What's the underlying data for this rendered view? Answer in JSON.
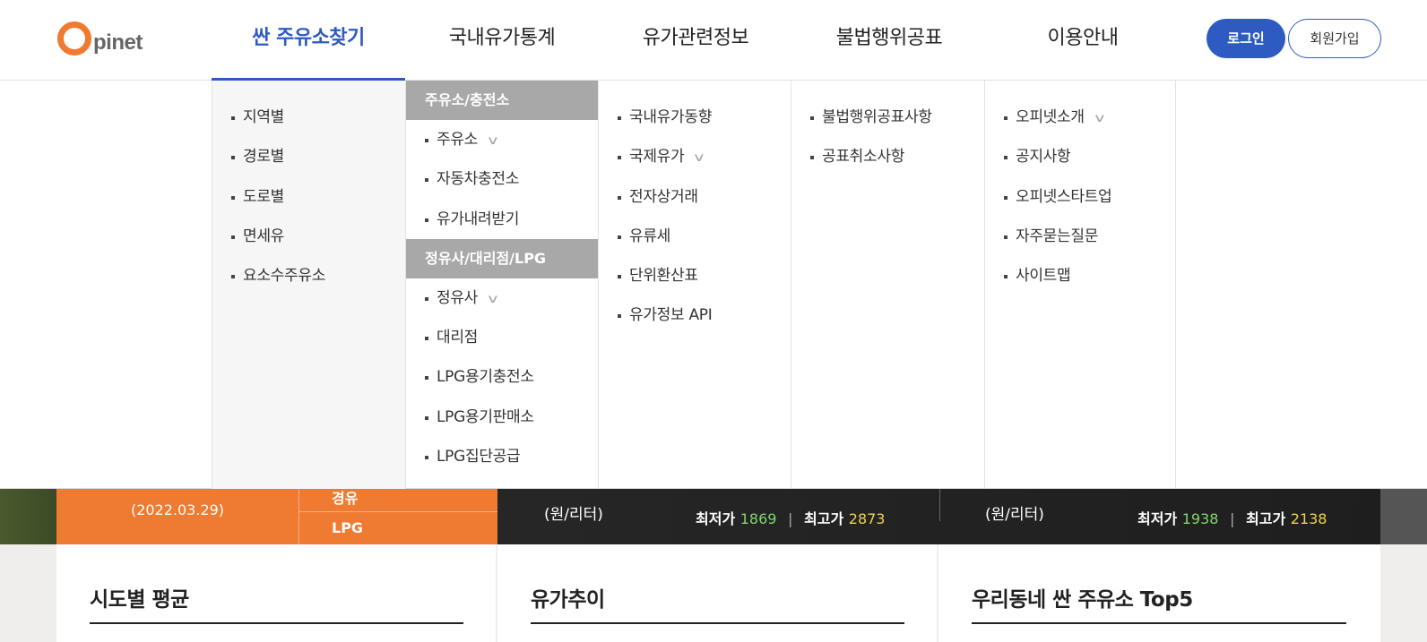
{
  "logo": {
    "text": "pinet"
  },
  "gnb": [
    {
      "label": "싼 주유소찾기"
    },
    {
      "label": "국내유가통계"
    },
    {
      "label": "유가관련정보"
    },
    {
      "label": "불법행위공표"
    },
    {
      "label": "이용안내"
    }
  ],
  "auth": {
    "login": "로그인",
    "join": "회원가입"
  },
  "menu": {
    "col1": [
      "지역별",
      "경로별",
      "도로별",
      "면세유",
      "요소수주유소"
    ],
    "col2": {
      "group1_title": "주유소/충전소",
      "group1": [
        "주유소",
        "자동차충전소",
        "유가내려받기"
      ],
      "group2_title": "정유사/대리점/LPG",
      "group2": [
        "정유사",
        "대리점",
        "LPG용기충전소",
        "LPG용기판매소",
        "LPG집단공급"
      ]
    },
    "col3": [
      "국내유가동향",
      "국제유가",
      "전자상거래",
      "유류세",
      "단위환산표",
      "유가정보 API"
    ],
    "col4": [
      "불법행위공표사항",
      "공표취소사항"
    ],
    "col5": [
      "오피넷소개",
      "공지사항",
      "오피넷스타트업",
      "자주묻는질문",
      "사이트맵"
    ],
    "chevron": "∨"
  },
  "banner": {
    "date": "(2022.03.29)",
    "diesel": "경유",
    "lpg": "LPG",
    "unit1": "(원/리터)",
    "unit2": "(원/리터)",
    "min_label": "최저가",
    "max_label": "최고가",
    "left": {
      "min": "1869",
      "max": "2873"
    },
    "right": {
      "min": "1938",
      "max": "2138"
    }
  },
  "panels": [
    {
      "title": "시도별 평균"
    },
    {
      "title": "유가추이"
    },
    {
      "title": "우리동네 싼 주유소 Top5"
    }
  ]
}
